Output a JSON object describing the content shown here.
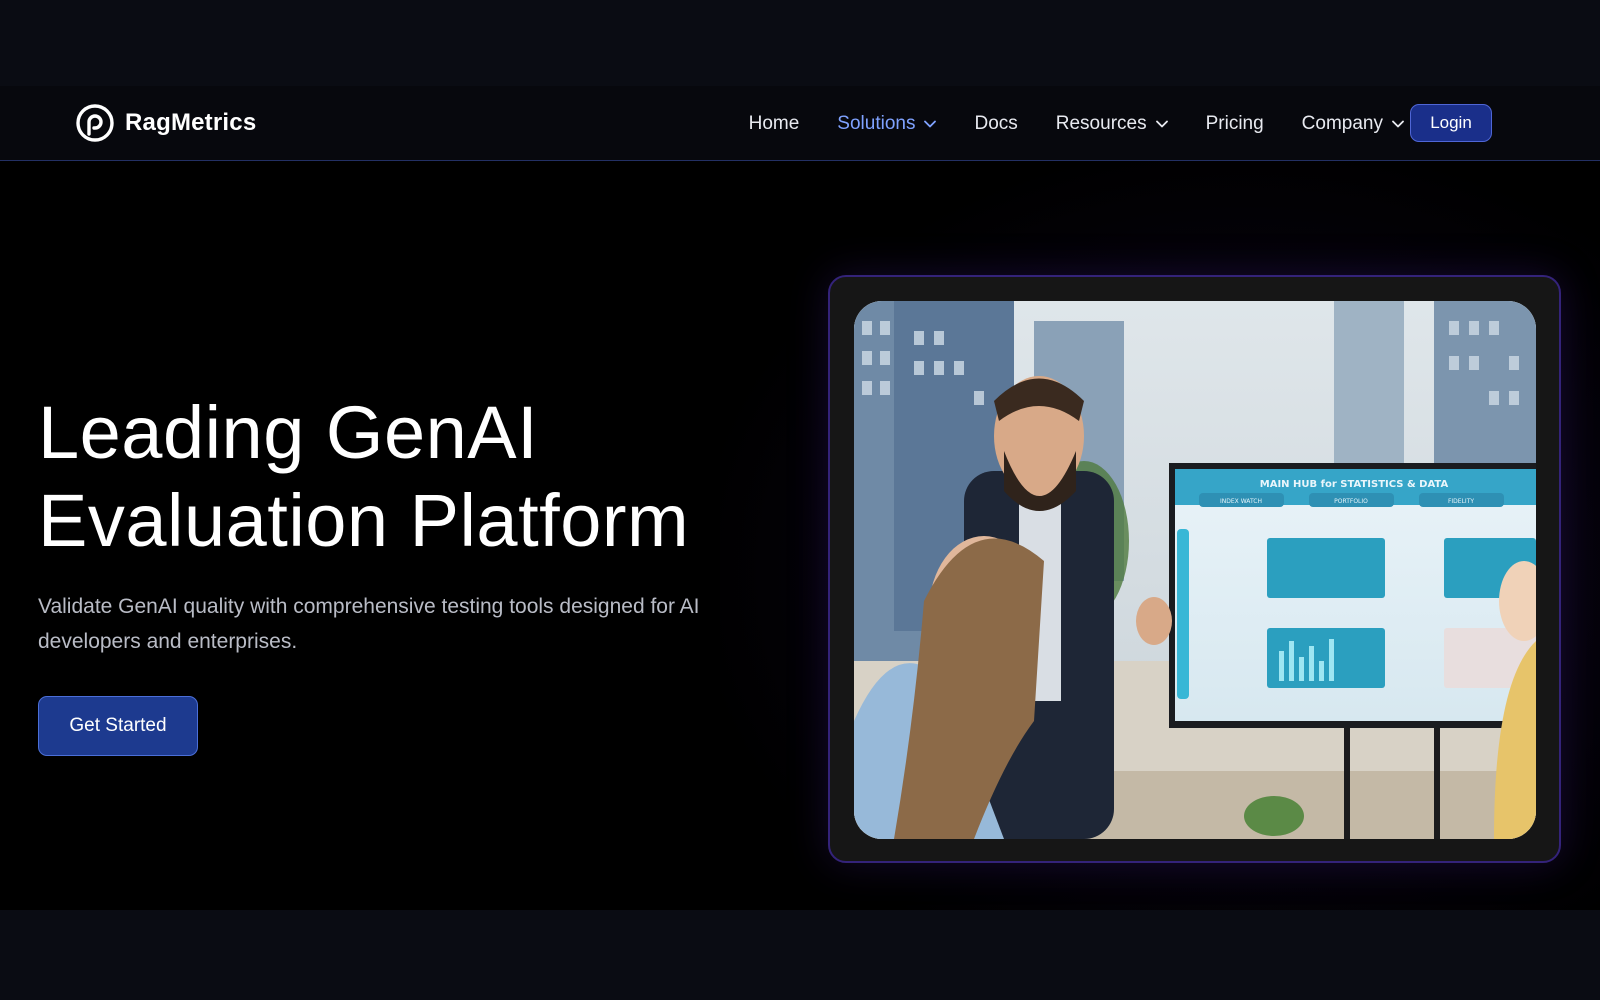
{
  "brand": {
    "name": "RagMetrics",
    "logo_icon": "ragmetrics-logo-icon"
  },
  "nav": {
    "items": [
      {
        "label": "Home",
        "has_dropdown": false,
        "active": false
      },
      {
        "label": "Solutions",
        "has_dropdown": true,
        "active": true
      },
      {
        "label": "Docs",
        "has_dropdown": false,
        "active": false
      },
      {
        "label": "Resources",
        "has_dropdown": true,
        "active": false
      },
      {
        "label": "Pricing",
        "has_dropdown": false,
        "active": false
      },
      {
        "label": "Company",
        "has_dropdown": true,
        "active": false
      }
    ],
    "login_label": "Login"
  },
  "hero": {
    "title_line1": "Leading GenAI",
    "title_line2": "Evaluation Platform",
    "subtitle": "Validate GenAI quality with comprehensive testing tools designed for AI developers and enterprises.",
    "cta_label": "Get Started",
    "media": {
      "screen_heading": "MAIN HUB for STATISTICS & DATA",
      "screen_tabs": [
        "INDEX WATCH",
        "PORTFOLIO",
        "FIDELITY"
      ]
    }
  },
  "colors": {
    "accent": "#7fa2ff",
    "button_bg": "#1d3a8f",
    "login_bg": "#1a2f8a",
    "frame_border": "#34237a",
    "page_bg": "#090b12",
    "hero_bg": "#000000"
  }
}
